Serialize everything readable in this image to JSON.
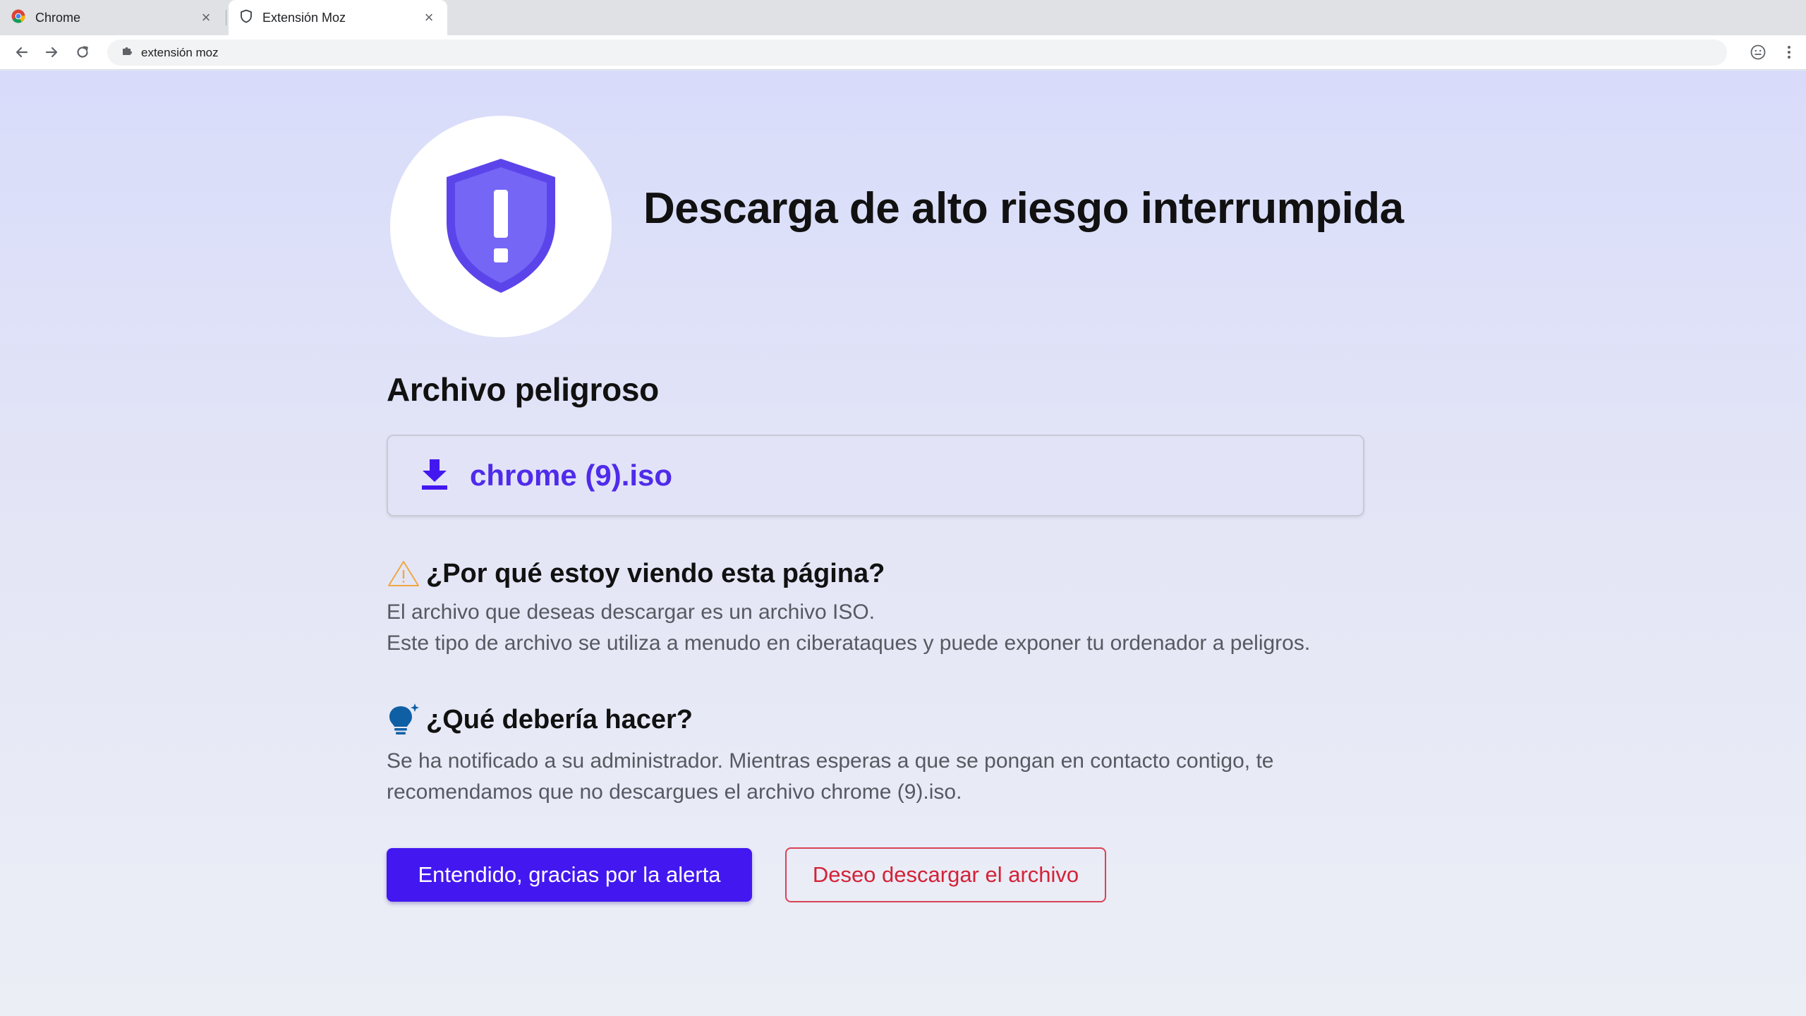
{
  "tabs": [
    {
      "label": "Chrome",
      "icon": "chrome-logo-icon",
      "close": "×"
    },
    {
      "label": "Extensión Moz",
      "icon": "shield-outline-icon",
      "close": "×",
      "active": true
    }
  ],
  "toolbar": {
    "address": "extensión moz",
    "address_icon": "puzzle-icon"
  },
  "page": {
    "title": "Descarga de alto riesgo interrumpida",
    "section_heading": "Archivo peligroso",
    "file_name": "chrome (9).iso",
    "why_heading": "¿Por qué estoy viendo esta página?",
    "why_lines": [
      "El archivo que deseas descargar es un archivo ISO.",
      "Este tipo de archivo se utiliza a menudo en ciberataques y puede exponer tu ordenador a peligros."
    ],
    "what_heading": "¿Qué debería hacer?",
    "what_lines": [
      "Se ha notificado a su administrador. Mientras esperas a que se pongan en contacto contigo, te",
      "recomendamos que no descargues el archivo chrome (9).iso."
    ],
    "primary_button": "Entendido, gracias por la alerta",
    "secondary_button": "Deseo descargar el archivo"
  },
  "colors": {
    "accent": "#4318f0",
    "file_name": "#4f2bea",
    "danger": "#d32237",
    "shield": "#6f63f4",
    "warning": "#f0a742",
    "bulb": "#0f5fa5"
  }
}
